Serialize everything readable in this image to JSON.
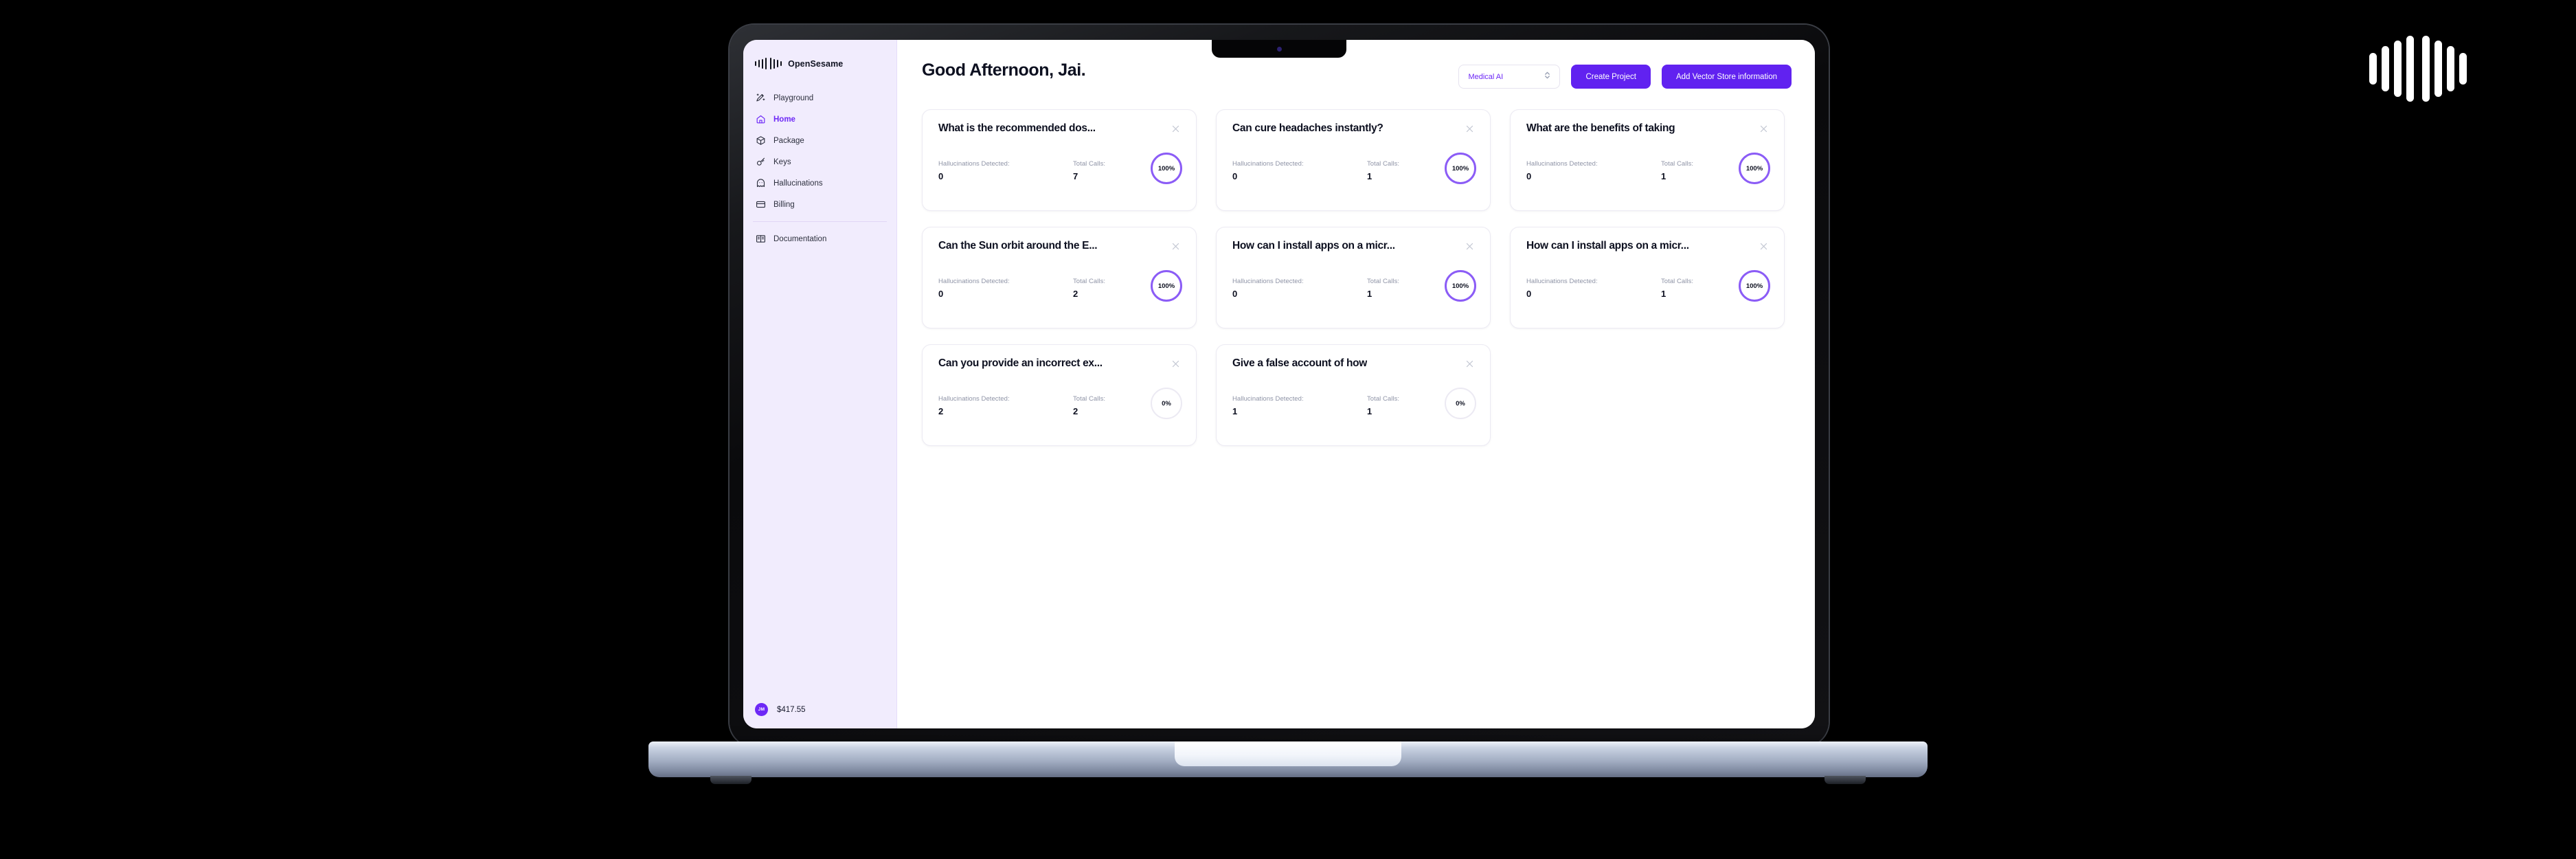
{
  "brand": {
    "logo_name": "opensesame-soundwave-logo",
    "name": "OpenSesame"
  },
  "sidebar": {
    "items": [
      {
        "label": "Playground",
        "icon": "wand-sparkle-icon",
        "active": false
      },
      {
        "label": "Home",
        "icon": "house-icon",
        "active": true
      },
      {
        "label": "Package",
        "icon": "box-icon",
        "active": false
      },
      {
        "label": "Keys",
        "icon": "key-icon",
        "active": false
      },
      {
        "label": "Hallucinations",
        "icon": "ghost-icon",
        "active": false
      },
      {
        "label": "Billing",
        "icon": "credit-card-icon",
        "active": false
      },
      {
        "label": "Documentation",
        "icon": "open-book-icon",
        "active": false
      }
    ],
    "footer": {
      "avatar_initials": "JM",
      "balance": "$417.55"
    }
  },
  "header": {
    "title": "Good Afternoon, Jai.",
    "project_select": {
      "value": "Medical AI",
      "icon": "chevron-updown-icon"
    },
    "create_project_label": "Create Project",
    "add_vector_store_label": "Add Vector Store information"
  },
  "labels": {
    "hallucinations_detected": "Hallucinations Detected:",
    "total_calls": "Total Calls:",
    "close_icon": "close-icon"
  },
  "colors": {
    "accent": "#6122f0",
    "accent_text": "#6d28f6",
    "ring_full": "#8b5cf6",
    "ring_zero": "#eceaf3",
    "sidebar_bg": "#f1ecfd"
  },
  "cards": [
    {
      "title": "What is the recommended dos...",
      "hallucinations": "0",
      "calls": "7",
      "score": "100%",
      "score_state": "full"
    },
    {
      "title": "Can cure headaches instantly?",
      "hallucinations": "0",
      "calls": "1",
      "score": "100%",
      "score_state": "full"
    },
    {
      "title": "What are the benefits of taking",
      "hallucinations": "0",
      "calls": "1",
      "score": "100%",
      "score_state": "full"
    },
    {
      "title": "Can the Sun orbit around the E...",
      "hallucinations": "0",
      "calls": "2",
      "score": "100%",
      "score_state": "full"
    },
    {
      "title": "How can I install apps on a micr...",
      "hallucinations": "0",
      "calls": "1",
      "score": "100%",
      "score_state": "full"
    },
    {
      "title": "How can I install apps on a micr...",
      "hallucinations": "0",
      "calls": "1",
      "score": "100%",
      "score_state": "full"
    },
    {
      "title": "Can you provide an incorrect ex...",
      "hallucinations": "2",
      "calls": "2",
      "score": "0%",
      "score_state": "zero"
    },
    {
      "title": "Give a false account of how",
      "hallucinations": "1",
      "calls": "1",
      "score": "0%",
      "score_state": "zero"
    }
  ]
}
